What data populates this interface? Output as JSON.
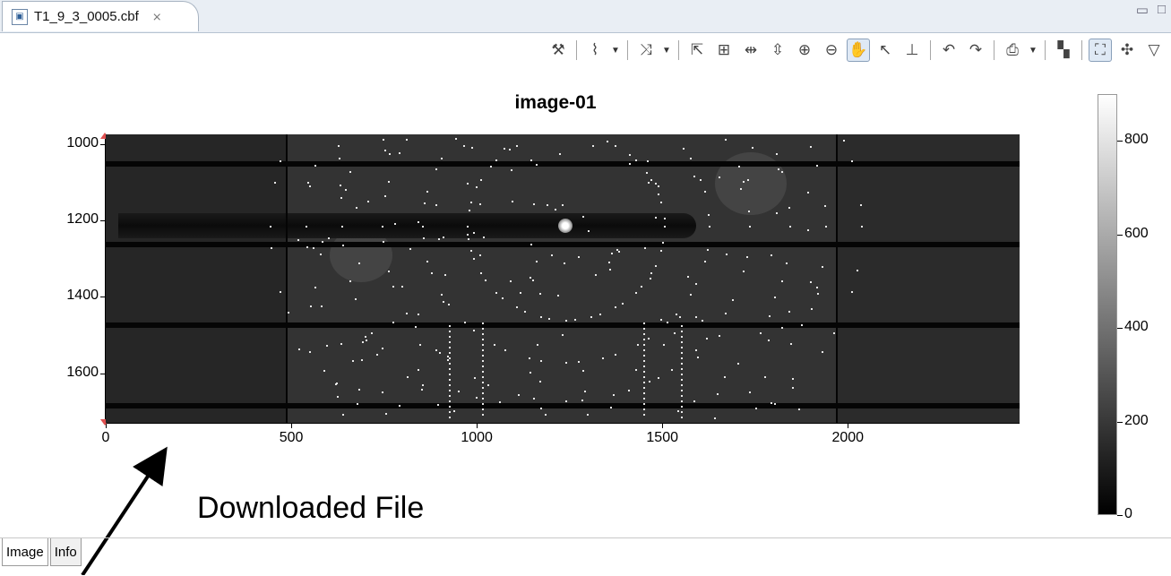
{
  "editor_tab": {
    "title": "T1_9_3_0005.cbf",
    "close_glyph": "⨯"
  },
  "window_controls": {
    "minimize": "▭",
    "maximize": "□"
  },
  "toolbar": {
    "items": [
      {
        "name": "configure-icon",
        "glyph": "⚒",
        "dropdown": false,
        "selected": false
      },
      {
        "sep": true
      },
      {
        "name": "axis-configure-icon",
        "glyph": "⌇",
        "dropdown": true,
        "selected": false
      },
      {
        "sep": true
      },
      {
        "name": "trace-configure-icon",
        "glyph": "⤨",
        "dropdown": true,
        "selected": false
      },
      {
        "sep": true
      },
      {
        "name": "autoscale-icon",
        "glyph": "⇱",
        "dropdown": false,
        "selected": false
      },
      {
        "name": "rubberband-zoom-icon",
        "glyph": "⊞",
        "dropdown": false,
        "selected": false
      },
      {
        "name": "horizontal-zoom-icon",
        "glyph": "⇹",
        "dropdown": false,
        "selected": false
      },
      {
        "name": "vertical-zoom-icon",
        "glyph": "⇳",
        "dropdown": false,
        "selected": false
      },
      {
        "name": "zoom-in-icon",
        "glyph": "⊕",
        "dropdown": false,
        "selected": false
      },
      {
        "name": "zoom-out-icon",
        "glyph": "⊖",
        "dropdown": false,
        "selected": false
      },
      {
        "name": "pan-icon",
        "glyph": "✋",
        "dropdown": false,
        "selected": true
      },
      {
        "name": "pointer-icon",
        "glyph": "↖",
        "dropdown": false,
        "selected": false
      },
      {
        "name": "axes-icon",
        "glyph": "⊥",
        "dropdown": false,
        "selected": false
      },
      {
        "sep": true
      },
      {
        "name": "undo-icon",
        "glyph": "↶",
        "dropdown": false,
        "selected": false
      },
      {
        "name": "redo-icon",
        "glyph": "↷",
        "dropdown": false,
        "selected": false
      },
      {
        "sep": true
      },
      {
        "name": "print-icon",
        "glyph": "⎙",
        "dropdown": true,
        "selected": false
      },
      {
        "sep": true
      },
      {
        "name": "histogram-icon",
        "glyph": "▚",
        "dropdown": false,
        "selected": false
      },
      {
        "sep": true
      },
      {
        "name": "fit-to-window-icon",
        "glyph": "⛶",
        "dropdown": false,
        "selected": true
      },
      {
        "name": "palette-icon",
        "glyph": "✣",
        "dropdown": false,
        "selected": false
      },
      {
        "name": "view-menu-icon",
        "glyph": "▽",
        "dropdown": false,
        "selected": false
      }
    ]
  },
  "plot": {
    "title": "image-01",
    "y_ticks": [
      {
        "label": "1000",
        "value": 1000
      },
      {
        "label": "1200",
        "value": 1200
      },
      {
        "label": "1400",
        "value": 1400
      },
      {
        "label": "1600",
        "value": 1600
      }
    ],
    "x_ticks": [
      {
        "label": "0",
        "value": 0
      },
      {
        "label": "500",
        "value": 500
      },
      {
        "label": "1000",
        "value": 1000
      },
      {
        "label": "1500",
        "value": 1500
      },
      {
        "label": "2000",
        "value": 2000
      }
    ],
    "x_range": [
      0,
      2463
    ],
    "y_range": [
      975,
      1730
    ],
    "colorbar": {
      "range": [
        0,
        900
      ],
      "ticks": [
        {
          "label": "800",
          "value": 800
        },
        {
          "label": "600",
          "value": 600
        },
        {
          "label": "400",
          "value": 400
        },
        {
          "label": "200",
          "value": 200
        },
        {
          "label": "0",
          "value": 0
        }
      ]
    }
  },
  "annotation": {
    "text": "Downloaded File"
  },
  "bottom_tabs": [
    {
      "label": "Image",
      "active": true
    },
    {
      "label": "Info",
      "active": false
    }
  ]
}
